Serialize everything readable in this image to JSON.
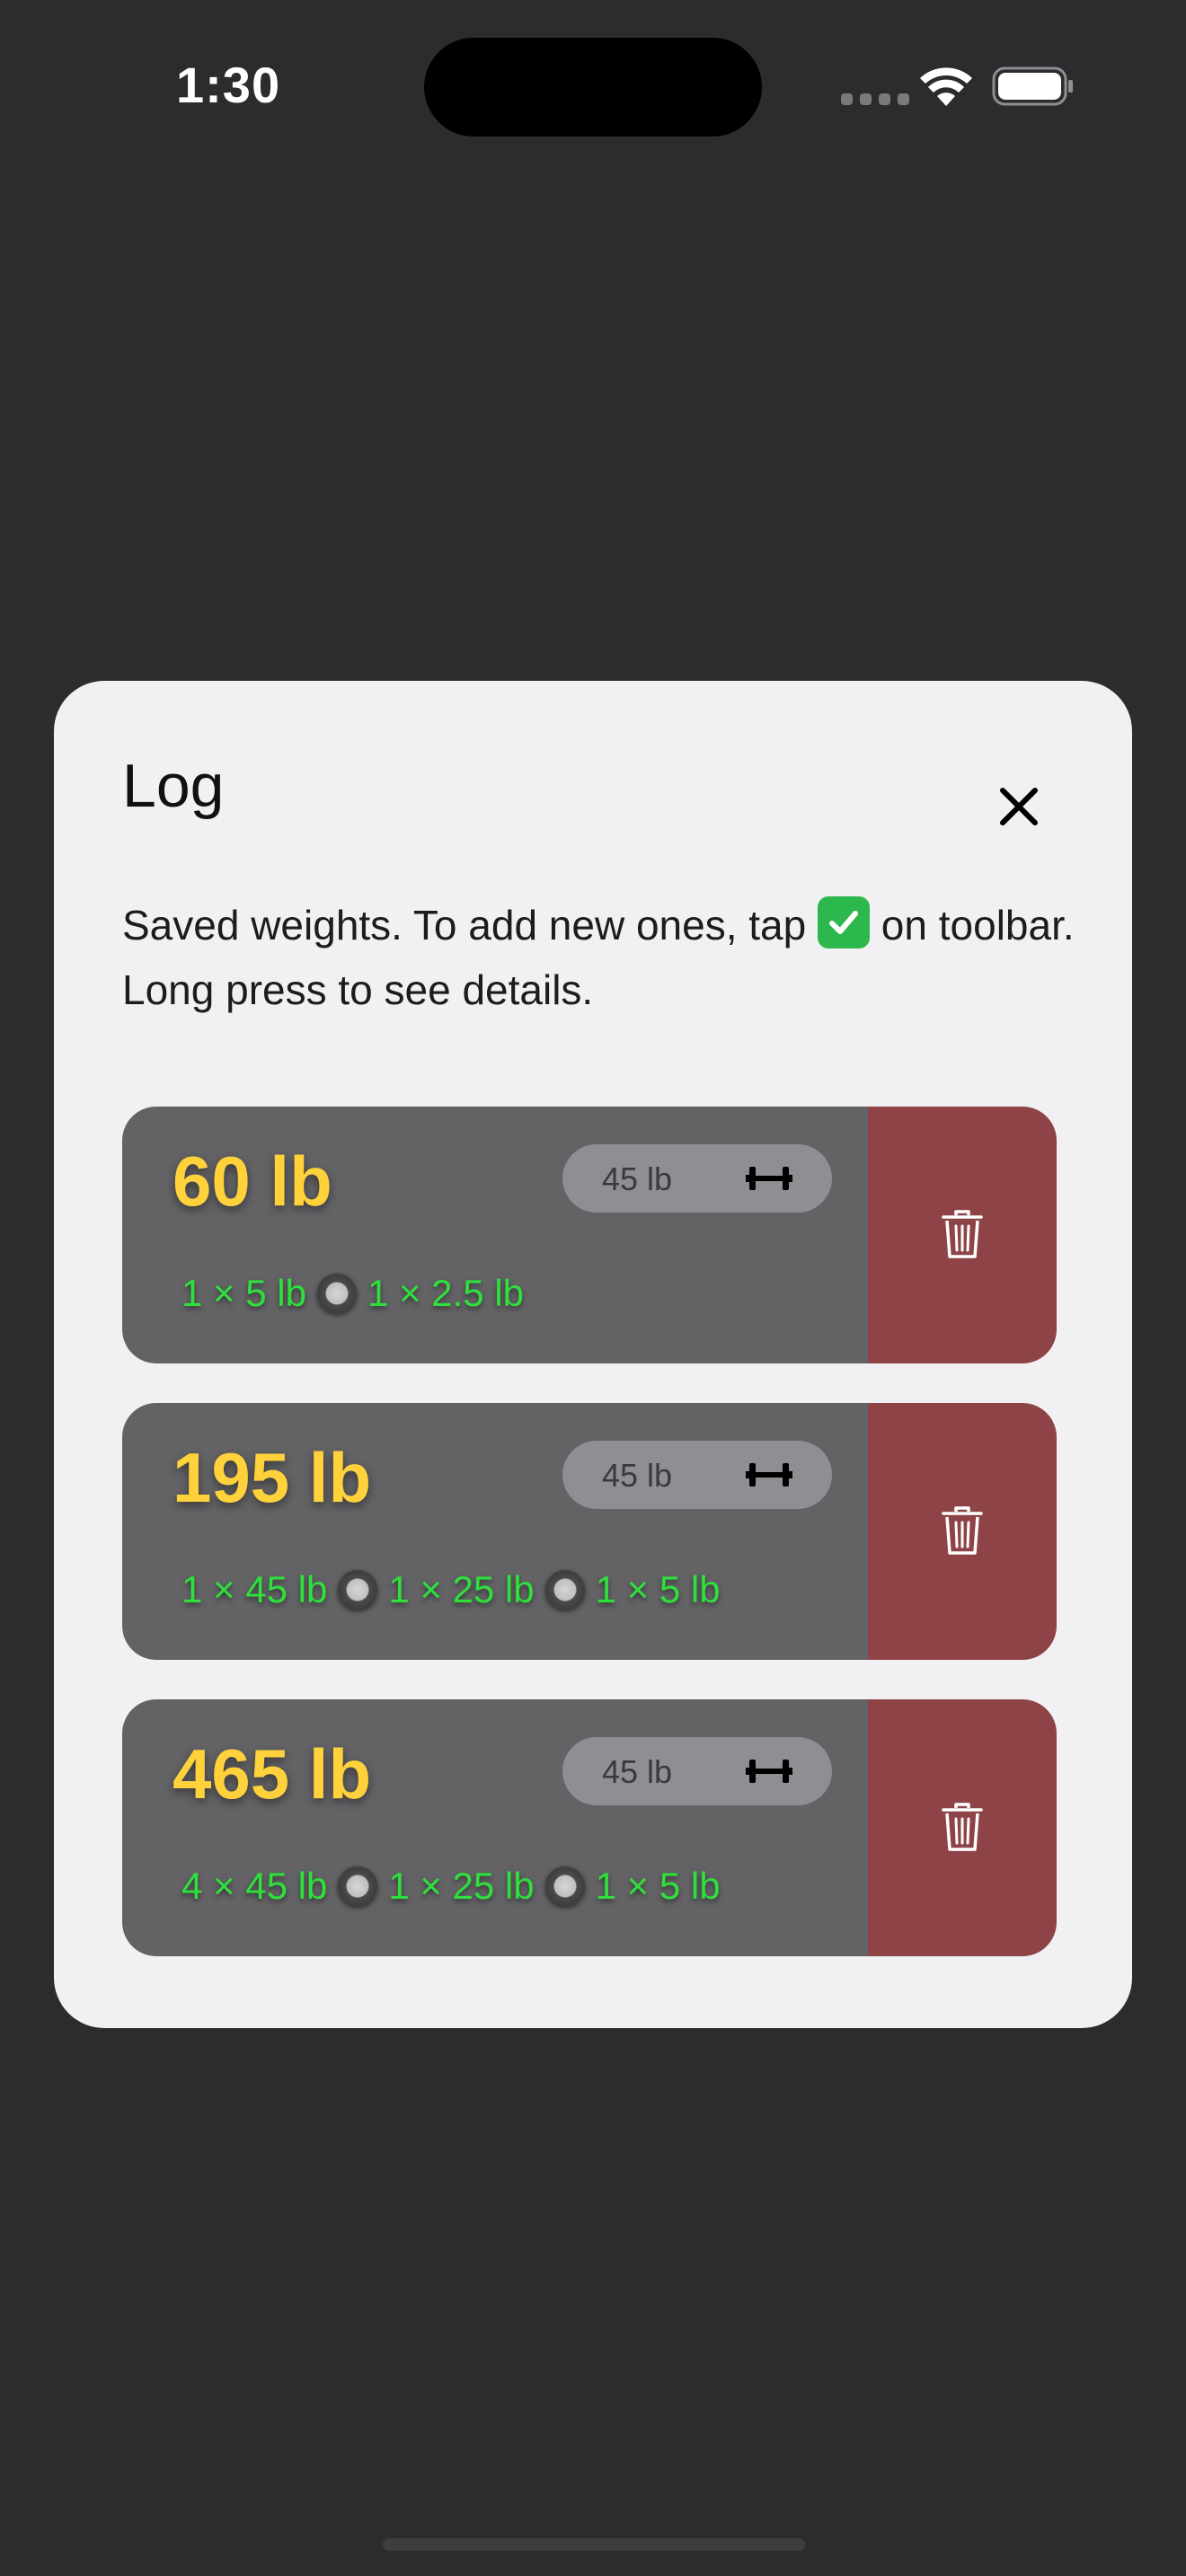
{
  "status_bar": {
    "time": "1:30"
  },
  "modal": {
    "title": "Log",
    "description_before": "Saved weights. To add new ones, tap ",
    "description_after": " on toolbar. Long press to see details.",
    "entries": [
      {
        "total": "60 lb",
        "bar": "45 lb",
        "plates": [
          "1 × 5 lb",
          "1 × 2.5 lb"
        ]
      },
      {
        "total": "195 lb",
        "bar": "45 lb",
        "plates": [
          "1 × 45 lb",
          "1 × 25 lb",
          "1 × 5 lb"
        ]
      },
      {
        "total": "465 lb",
        "bar": "45 lb",
        "plates": [
          "4 × 45 lb",
          "1 × 25 lb",
          "1 × 5 lb"
        ]
      }
    ]
  },
  "icons": {
    "close": "close-icon",
    "check": "check-box-icon",
    "barbell": "barbell-icon",
    "delete": "trash-icon",
    "plate_separator": "plate-icon"
  },
  "colors": {
    "background": "#2c2c2e",
    "modal_background": "#f1f1f3",
    "entry_background": "#636366",
    "total_text": "#ffd23c",
    "plate_text": "#2fe03c",
    "delete_background": "#8e4447",
    "bar_pill": "#8e8e93"
  }
}
